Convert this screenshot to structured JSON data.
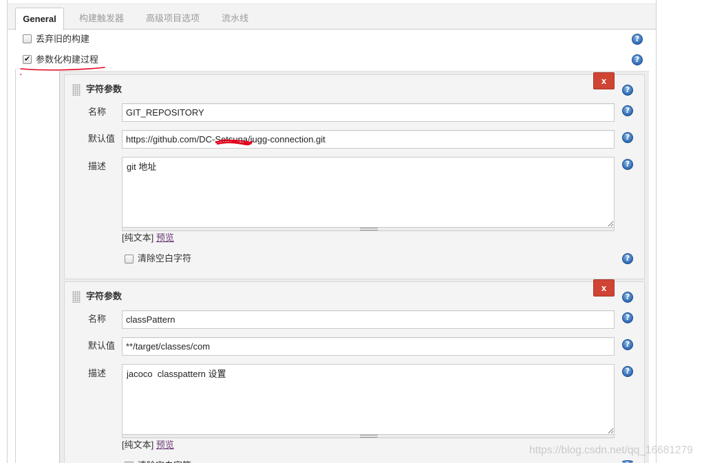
{
  "tabs": [
    "General",
    "构建触发器",
    "高级项目选项",
    "流水线"
  ],
  "general": {
    "discard_old_builds": {
      "label": "丢弃旧的构建",
      "checked": false
    },
    "parameterized_build": {
      "label": "参数化构建过程",
      "checked": true
    }
  },
  "help_icon": "?",
  "parameters": [
    {
      "type": "字符参数",
      "delete": "x",
      "name": {
        "label": "名称",
        "value": "GIT_REPOSITORY"
      },
      "default_value": {
        "label": "默认值",
        "value": "https://github.com/DC-Setsuna/jugg-connection.git"
      },
      "description": {
        "label": "描述",
        "value": "git 地址",
        "format": "[纯文本]",
        "preview": "预览"
      },
      "trim": {
        "label": "清除空白字符",
        "checked": false
      }
    },
    {
      "type": "字符参数",
      "delete": "x",
      "name": {
        "label": "名称",
        "value": "classPattern"
      },
      "default_value": {
        "label": "默认值",
        "value": "**/target/classes/com"
      },
      "description": {
        "label": "描述",
        "value": "jacoco  classpattern 设置",
        "format": "[纯文本]",
        "preview": "预览"
      },
      "trim": {
        "label": "清除空白字符",
        "checked": false
      }
    }
  ],
  "watermark": "https://blog.csdn.net/qq_16681279",
  "colors": {
    "delete_button": "#d04434",
    "help_icon": "#2f69b3",
    "link": "#6b3a78",
    "annotation": "#e4001b"
  }
}
